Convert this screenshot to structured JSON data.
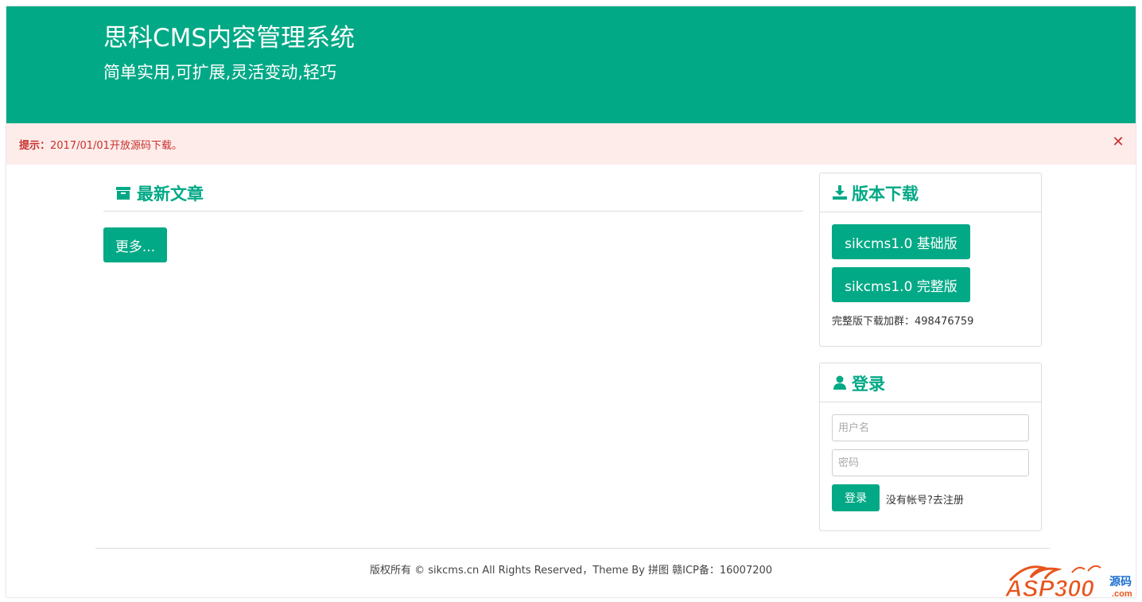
{
  "hero": {
    "title": "思科CMS内容管理系统",
    "subtitle": "简单实用,可扩展,灵活变动,轻巧"
  },
  "alert": {
    "label": "提示：",
    "message": "2017/01/01开放源码下载。",
    "close_glyph": "✕"
  },
  "main": {
    "section_title": "最新文章",
    "section_icon": "archive-icon",
    "more_label": "更多..."
  },
  "download": {
    "title": "版本下载",
    "icon": "download-icon",
    "basic_label": "sikcms1.0 基础版",
    "full_label": "sikcms1.0 完整版",
    "note": "完整版下载加群：498476759"
  },
  "login": {
    "title": "登录",
    "icon": "user-icon",
    "username_placeholder": "用户名",
    "password_placeholder": "密码",
    "submit_label": "登录",
    "register_label": "没有帐号?去注册"
  },
  "footer": {
    "text": "版权所有 © sikcms.cn All Rights Reserved，Theme By 拼图  赣ICP备：16007200"
  },
  "watermark": {
    "brand": "ASP300",
    "suffix": "源码",
    "domain": ".com"
  },
  "colors": {
    "brand": "#02a986",
    "alert_bg": "#fdecea",
    "alert_text": "#c9302c"
  }
}
